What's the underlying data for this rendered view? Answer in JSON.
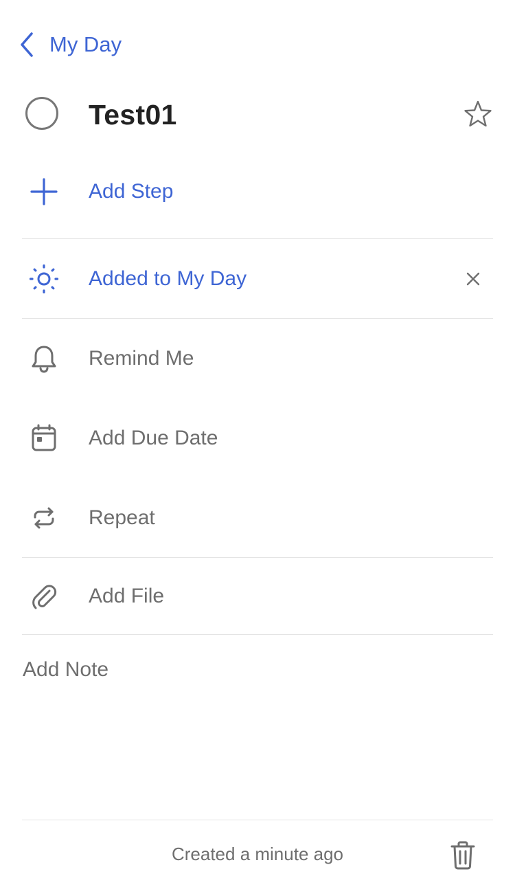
{
  "nav": {
    "back_label": "My Day"
  },
  "task": {
    "title": "Test01"
  },
  "steps": {
    "add_step_label": "Add Step"
  },
  "my_day": {
    "label": "Added to My Day"
  },
  "options": {
    "remind_label": "Remind Me",
    "due_date_label": "Add Due Date",
    "repeat_label": "Repeat",
    "file_label": "Add File"
  },
  "note": {
    "placeholder": "Add Note"
  },
  "footer": {
    "created_text": "Created a minute ago"
  },
  "colors": {
    "accent": "#3e65d4",
    "muted": "#6e6e6e",
    "title": "#222222",
    "divider": "#e4e4e4"
  },
  "icons": {
    "back": "chevron-left-icon",
    "complete": "circle-icon",
    "star": "star-icon",
    "add": "plus-icon",
    "my_day": "sun-icon",
    "close": "close-icon",
    "remind": "bell-icon",
    "due": "calendar-icon",
    "repeat": "repeat-icon",
    "file": "paperclip-icon",
    "delete": "trash-icon"
  }
}
